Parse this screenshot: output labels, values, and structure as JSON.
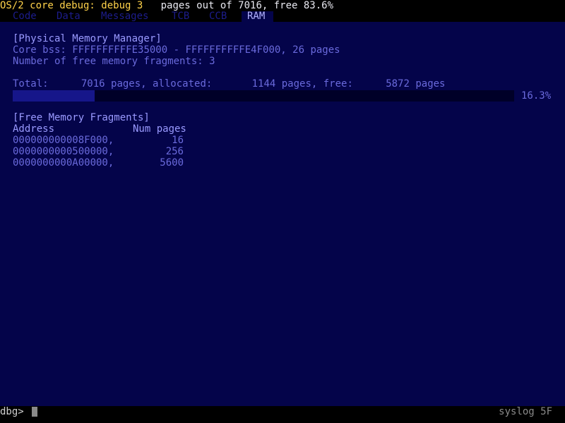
{
  "title": {
    "main": "OS/2 core debug: debug 3",
    "info": "pages out of 7016, free 83.6%"
  },
  "tabs": [
    {
      "label": "Code",
      "active": false
    },
    {
      "label": "Data",
      "active": false
    },
    {
      "label": "Messages",
      "active": false
    },
    {
      "label": "TCB",
      "active": false
    },
    {
      "label": "CCB",
      "active": false
    },
    {
      "label": "RAM",
      "active": true
    }
  ],
  "pmm": {
    "header": "[Physical Memory Manager]",
    "core_bss_label": "Core bss:",
    "core_bss_range": "FFFFFFFFFFE35000 - FFFFFFFFFFE4F000, 26 pages",
    "fragments_label": "Number of free memory fragments:",
    "fragments_count": "3"
  },
  "totals": {
    "total_label": "Total:",
    "total_pages": "7016",
    "pages_word_1": "pages, allocated:",
    "allocated_pages": "1144",
    "pages_word_2": "pages, free:",
    "free_pages": "5872",
    "pages_word_3": "pages",
    "allocated_percent_text": "16.3%",
    "allocated_fraction": 0.163
  },
  "fragments": {
    "header": "[Free Memory Fragments]",
    "col_address": "Address",
    "col_pages": "Num pages",
    "rows": [
      {
        "address": "000000000008F000,",
        "pages": "16"
      },
      {
        "address": "0000000000500000,",
        "pages": "256"
      },
      {
        "address": "0000000000A00000,",
        "pages": "5600"
      }
    ]
  },
  "status": {
    "prompt": "dbg>",
    "input_value": "",
    "syslog": "syslog 5F"
  },
  "colors": {
    "background": "#04044a",
    "title_accent": "#ffd24a",
    "text": "#6a6adc",
    "progress_fill": "#16168a"
  }
}
